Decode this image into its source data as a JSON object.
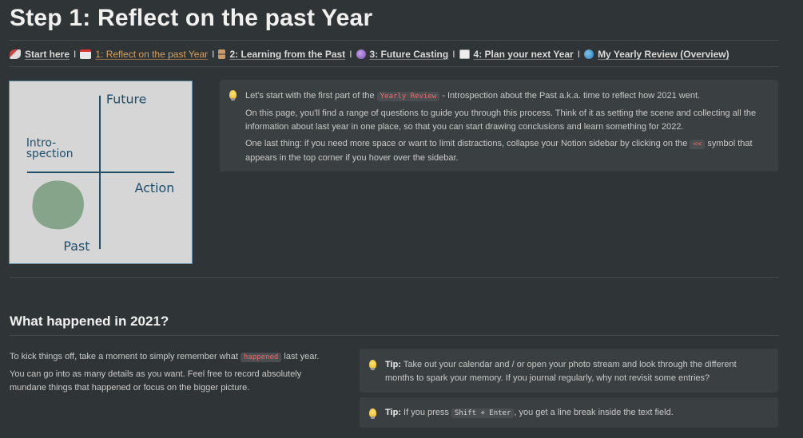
{
  "page": {
    "title": "Step 1: Reflect on the past Year"
  },
  "nav": {
    "separator": "I",
    "items": [
      {
        "label": "Start here",
        "icon": "rocket-icon"
      },
      {
        "label": "1: Reflect on the past Year",
        "icon": "calendar-icon",
        "active": true
      },
      {
        "label": "2: Learning from the Past",
        "icon": "hourglass-icon"
      },
      {
        "label": "3: Future Casting",
        "icon": "crystal-ball-icon"
      },
      {
        "label": "4: Plan your next Year",
        "icon": "chart-icon"
      },
      {
        "label": "My Yearly Review (Overview)",
        "icon": "globe-icon"
      }
    ]
  },
  "diagram": {
    "top_label": "Future",
    "left_label_1": "Intro-",
    "left_label_2": "spection",
    "right_label": "Action",
    "bottom_label": "Past",
    "blob_color": "#86a48a",
    "ink_color": "#1f4e6b"
  },
  "intro_callout": {
    "icon": "lightbulb-icon",
    "p1_before": "Let's start with the first part of the",
    "p1_code": "Yearly Review",
    "p1_after": "- Introspection about the Past a.k.a. time to reflect how 2021 went.",
    "p2": "On this page, you'll find a range of questions to guide you through this process. Think of it as setting the scene and collecting all the information about last year in one place, so that you can start drawing conclusions and learn something for 2022.",
    "p3_before": "One last thing: if you need more space or want to limit distractions, collapse your Notion sidebar by clicking on the",
    "p3_code": "<<",
    "p3_after": "symbol that appears in the top corner if you hover over the sidebar."
  },
  "section": {
    "heading": "What happened in 2021?",
    "p1_before": "To kick things off, take a moment to simply remember what",
    "p1_code": "happened",
    "p1_after": "last year.",
    "p2": "You can go into as many details as you want. Feel free to record absolutely mundane things that happened or focus on the bigger picture."
  },
  "tip1": {
    "icon": "lightbulb-icon",
    "label": "Tip:",
    "text": "Take out your calendar and / or open your photo stream and look through the different months to spark your memory. If you journal regularly, why not revisit some entries?"
  },
  "tip2": {
    "icon": "lightbulb-icon",
    "label": "Tip:",
    "before": "If you press",
    "code": "Shift + Enter",
    "after": ", you get a line break inside the text field."
  },
  "colors": {
    "background": "#2f3437",
    "callout": "#3a3f42",
    "active_link": "#d9a15c",
    "inline_code": "#ea6b6b"
  }
}
